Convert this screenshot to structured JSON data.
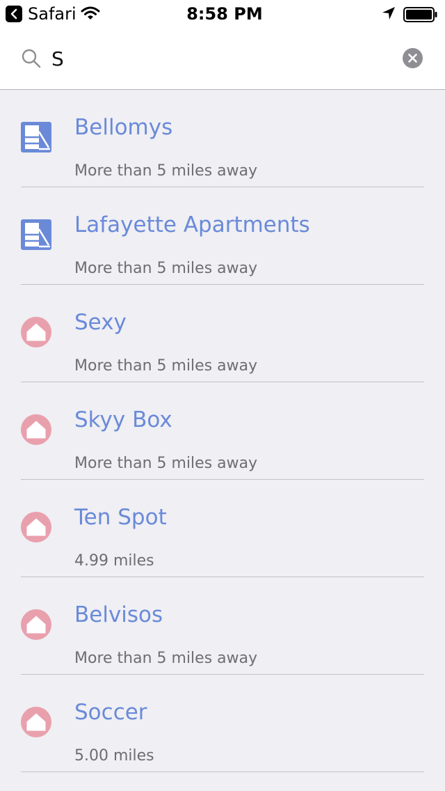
{
  "status_bar": {
    "back_app": "Safari",
    "time": "8:58 PM"
  },
  "search": {
    "value": "S",
    "placeholder": ""
  },
  "results": [
    {
      "name": "Bellomys",
      "distance": "More than 5 miles away",
      "icon": "building-icon"
    },
    {
      "name": "Lafayette Apartments",
      "distance": "More than 5 miles away",
      "icon": "building-icon"
    },
    {
      "name": "Sexy",
      "distance": "More than 5 miles away",
      "icon": "house-icon"
    },
    {
      "name": "Skyy Box",
      "distance": "More than 5 miles away",
      "icon": "house-icon"
    },
    {
      "name": "Ten Spot",
      "distance": "4.99 miles",
      "icon": "house-icon"
    },
    {
      "name": "Belvisos",
      "distance": "More than 5 miles away",
      "icon": "house-icon"
    },
    {
      "name": "Soccer",
      "distance": "5.00 miles",
      "icon": "house-icon"
    }
  ],
  "colors": {
    "accent_blue": "#6a8ad8",
    "house_pink": "#e9a0ad",
    "background": "#efeff4"
  }
}
